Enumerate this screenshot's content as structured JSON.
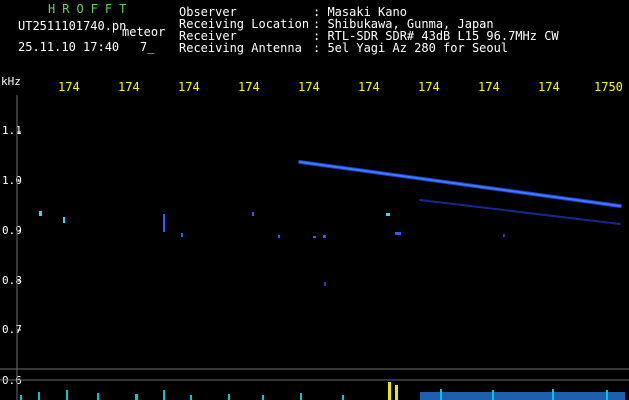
{
  "header": {
    "app_name": "HROFFT",
    "filename": "UT2511101740.pn",
    "filename_suffix": "meteor",
    "datetime": "25.11.10 17:40",
    "count": "7_",
    "info": [
      {
        "label": "Observer",
        "value": ": Masaki Kano"
      },
      {
        "label": "Receiving Location",
        "value": ": Shibukawa, Gunma, Japan"
      },
      {
        "label": "Receiver",
        "value": ": RTL-SDR SDR# 43dB L15 96.7MHz CW"
      },
      {
        "label": "Receiving Antenna",
        "value": ": 5el Yagi Az 280 for Seoul"
      }
    ]
  },
  "x_axis": {
    "ticks": [
      "174",
      "174",
      "174",
      "174",
      "174",
      "174",
      "174",
      "174",
      "174",
      "1750"
    ]
  },
  "y_axis": {
    "unit": "kHz",
    "ticks": [
      "1.1",
      "1.0",
      "0.9",
      "0.8",
      "0.7",
      "0.6"
    ]
  },
  "colors": {
    "background": "#000000",
    "header_text": "#ffffff",
    "app_name": "#5fd35f",
    "tick_labels": "#ffff00",
    "signal": "#2a5cff",
    "spectrum_bars": "#00c8d8"
  }
}
